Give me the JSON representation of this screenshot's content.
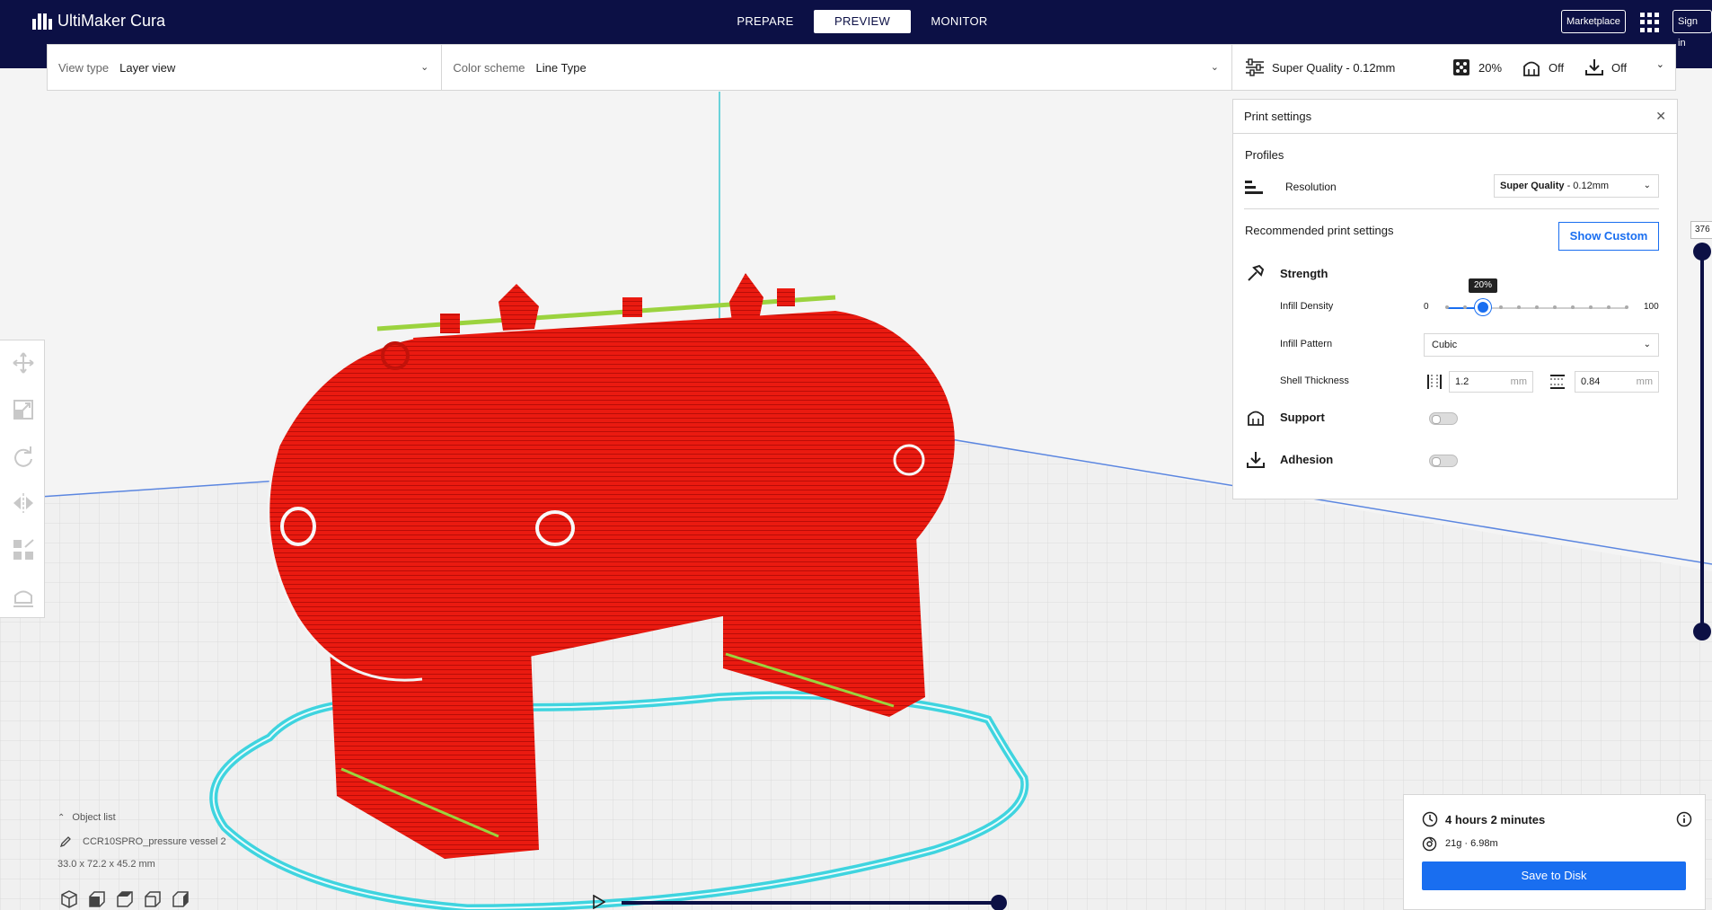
{
  "app": {
    "brand": "UltiMaker Cura"
  },
  "stages": [
    {
      "label": "PREPARE"
    },
    {
      "label": "PREVIEW"
    },
    {
      "label": "MONITOR"
    }
  ],
  "header": {
    "marketplace": "Marketplace",
    "signin": "Sign in"
  },
  "viewbar": {
    "view_type_label": "View type",
    "view_type_value": "Layer view",
    "color_scheme_label": "Color scheme",
    "color_scheme_value": "Line Type"
  },
  "quick_settings": {
    "profile": "Super Quality - 0.12mm",
    "infill": "20%",
    "support": "Off",
    "adhesion": "Off"
  },
  "print_settings": {
    "title": "Print settings",
    "profiles_label": "Profiles",
    "resolution_label": "Resolution",
    "resolution_bold": "Super Quality",
    "resolution_rest": " - 0.12mm",
    "recommended_label": "Recommended print settings",
    "show_custom": "Show Custom",
    "strength_label": "Strength",
    "infill_density_label": "Infill Density",
    "infill_min": "0",
    "infill_max": "100",
    "infill_value_text": "20%",
    "infill_value": 0.2,
    "infill_pattern_label": "Infill Pattern",
    "infill_pattern_value": "Cubic",
    "shell_thickness_label": "Shell Thickness",
    "wall_value": "1.2",
    "top_bottom_value": "0.84",
    "unit": "mm",
    "support_label": "Support",
    "adhesion_label": "Adhesion"
  },
  "layer_slider": {
    "value": "376"
  },
  "object_list": {
    "toggle_label": "Object list",
    "object_name": "CCR10SPRO_pressure vessel 2",
    "dimensions": "33.0 x 72.2 x 45.2 mm"
  },
  "job": {
    "time": "4 hours 2 minutes",
    "material": "21g · 6.98m",
    "save": "Save to Disk"
  },
  "colors": {
    "header_bg": "#0c1045",
    "accent": "#196ef0",
    "model_red": "#e8170f",
    "skirt_cyan": "#3fd4df"
  },
  "icons": [
    "cura-logo-icon",
    "apps-grid-icon",
    "settings-sliders-icon",
    "infill-icon",
    "support-icon",
    "adhesion-icon",
    "close-icon",
    "chevron-down-icon",
    "resolution-icon",
    "strength-icon",
    "wall-thickness-icon",
    "top-bottom-thickness-icon",
    "move-icon",
    "scale-icon",
    "rotate-icon",
    "mirror-icon",
    "per-model-settings-icon",
    "support-blocker-icon",
    "clock-icon",
    "spool-icon",
    "info-icon",
    "play-icon",
    "3d-view-icon",
    "front-view-icon",
    "top-view-icon",
    "left-view-icon",
    "right-view-icon",
    "pencil-icon",
    "chevron-up-icon"
  ]
}
